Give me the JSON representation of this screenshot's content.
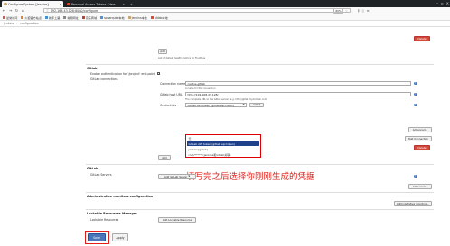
{
  "browser": {
    "tabs": [
      {
        "label": "Configure System [Jenkins]",
        "active": true
      },
      {
        "label": "Personal Access Tokens · Vers",
        "active": false
      }
    ],
    "url": "192.168.43.128:8080/configure",
    "zoom": "80%",
    "bookmarks": [
      "最常访问",
      "火狐官方站点",
      "新手上路",
      "常用网址",
      "京东商城",
      "sonarqube本地",
      "jenkins本地",
      "gitlab本地"
    ]
  },
  "breadcrumb": [
    "Jenkins",
    "configuration"
  ],
  "content": {
    "top_delete": "Delete",
    "add_button": "Add",
    "add_help": "List of default health metrics for Fluidtrue",
    "gitlab": {
      "title": "Gitlab",
      "enable_auth_label": "Enable authentication for '/project' end-point",
      "enable_auth_checked": "✔",
      "connections_label": "GitLab connections",
      "connection_name_label": "Connection name",
      "connection_name_value": "centos-gitlab",
      "connection_name_help": "A name for the connection",
      "host_url_label": "Gitlab host URL",
      "host_url_value": "http://192.168.43.128/",
      "host_url_help": "The complete URL to the Gitlab server (e.g. http://gitlab.mydomain.com)",
      "credentials_label": "Credentials",
      "credentials_selected": "GitLab API token (gitlab api token)",
      "credentials_add": "Add",
      "dropdown_options": [
        "无",
        "GitLab API token (gitlab api token)",
        "jenkins(gitlab)",
        "root/******(jenkins和Gitlab关联)"
      ],
      "advanced_button": "Advanced...",
      "test_connection_button": "Test Connection",
      "delete_button": "Delete",
      "add_button": "Add"
    },
    "annotation": "填写完之后选择你刚刚生成的凭据",
    "gitlab_servers": {
      "title": "GitLab",
      "servers_label": "GitLab Servers",
      "add_server_button": "Add GitLab Server",
      "advanced_button": "Advanced..."
    },
    "admin_monitors": {
      "title": "Administrative monitors configuration",
      "advanced_button": "Administrative monitors..."
    },
    "lockable": {
      "title": "Lockable Resources Manager",
      "resources_label": "Lockable Resources",
      "add_button": "Add Lockable Resource"
    },
    "footer": {
      "save": "Save",
      "apply": "Apply"
    }
  },
  "colors": {
    "annotation_red": "#e0201a",
    "jenkins_blue": "#4b75b9",
    "delete_red": "#d24939",
    "dropdown_highlight": "#1e3f8a"
  }
}
